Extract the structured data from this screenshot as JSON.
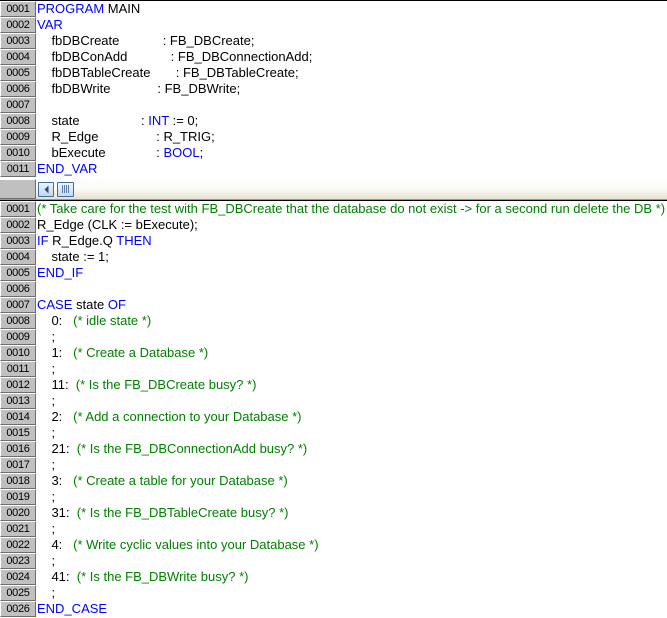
{
  "editor": {
    "title": "Structured Text Editor",
    "colors": {
      "keyword": "#0000ff",
      "comment": "#008000",
      "identifier": "#000000",
      "gutter_bg": "#c0c0c0",
      "editor_bg": "#ffffff"
    }
  },
  "declaration_pane": {
    "name": "declaration-editor",
    "lines": [
      {
        "num": "0001",
        "parts": [
          {
            "t": "PROGRAM ",
            "c": "kw"
          },
          {
            "t": "MAIN",
            "c": "plain"
          }
        ]
      },
      {
        "num": "0002",
        "parts": [
          {
            "t": "VAR",
            "c": "kw"
          }
        ]
      },
      {
        "num": "0003",
        "parts": [
          {
            "t": "    fbDBCreate            : FB_DBCreate;",
            "c": "plain"
          }
        ]
      },
      {
        "num": "0004",
        "parts": [
          {
            "t": "    fbDBConAdd            : FB_DBConnectionAdd;",
            "c": "plain"
          }
        ]
      },
      {
        "num": "0005",
        "parts": [
          {
            "t": "    fbDBTableCreate       : FB_DBTableCreate;",
            "c": "plain"
          }
        ]
      },
      {
        "num": "0006",
        "parts": [
          {
            "t": "    fbDBWrite             : FB_DBWrite;",
            "c": "plain"
          }
        ]
      },
      {
        "num": "0007",
        "parts": [
          {
            "t": "",
            "c": "plain"
          }
        ]
      },
      {
        "num": "0008",
        "parts": [
          {
            "t": "    state                 : ",
            "c": "plain"
          },
          {
            "t": "INT",
            "c": "kw"
          },
          {
            "t": " := 0;",
            "c": "plain"
          }
        ]
      },
      {
        "num": "0009",
        "parts": [
          {
            "t": "    R_Edge                : R_TRIG;",
            "c": "plain"
          }
        ]
      },
      {
        "num": "0010",
        "parts": [
          {
            "t": "    bExecute              : ",
            "c": "plain"
          },
          {
            "t": "BOOL",
            "c": "kw"
          },
          {
            "t": ";",
            "c": "plain"
          }
        ]
      },
      {
        "num": "0011",
        "parts": [
          {
            "t": "END_VAR",
            "c": "kw"
          }
        ]
      }
    ]
  },
  "scrollbar": {
    "name": "declaration-horizontal-scrollbar",
    "left_arrow_icon": "chevron-left-icon",
    "thumb_icon": "scrollbar-thumb-grip",
    "orientation": "horizontal"
  },
  "code_pane": {
    "name": "implementation-editor",
    "lines": [
      {
        "num": "0001",
        "parts": [
          {
            "t": "(* Take care for the test with FB_DBCreate that the database do not exist -> for a second run delete the DB *)",
            "c": "cmt"
          }
        ]
      },
      {
        "num": "0002",
        "parts": [
          {
            "t": "R_Edge (CLK := bExecute);",
            "c": "plain"
          }
        ]
      },
      {
        "num": "0003",
        "parts": [
          {
            "t": "IF",
            "c": "kw"
          },
          {
            "t": " R_Edge.Q ",
            "c": "plain"
          },
          {
            "t": "THEN",
            "c": "kw"
          }
        ]
      },
      {
        "num": "0004",
        "parts": [
          {
            "t": "    state := 1;",
            "c": "plain"
          }
        ]
      },
      {
        "num": "0005",
        "parts": [
          {
            "t": "END_IF",
            "c": "kw"
          }
        ]
      },
      {
        "num": "0006",
        "parts": [
          {
            "t": "",
            "c": "plain"
          }
        ]
      },
      {
        "num": "0007",
        "parts": [
          {
            "t": "CASE",
            "c": "kw"
          },
          {
            "t": " state ",
            "c": "plain"
          },
          {
            "t": "OF",
            "c": "kw"
          }
        ]
      },
      {
        "num": "0008",
        "parts": [
          {
            "t": "    0:   ",
            "c": "plain"
          },
          {
            "t": "(* idle state *)",
            "c": "cmt"
          }
        ]
      },
      {
        "num": "0009",
        "parts": [
          {
            "t": "    ;",
            "c": "plain"
          }
        ]
      },
      {
        "num": "0010",
        "parts": [
          {
            "t": "    1:   ",
            "c": "plain"
          },
          {
            "t": "(* Create a Database *)",
            "c": "cmt"
          }
        ]
      },
      {
        "num": "0011",
        "parts": [
          {
            "t": "    ;",
            "c": "plain"
          }
        ]
      },
      {
        "num": "0012",
        "parts": [
          {
            "t": "    11:  ",
            "c": "plain"
          },
          {
            "t": "(* Is the FB_DBCreate busy? *)",
            "c": "cmt"
          }
        ]
      },
      {
        "num": "0013",
        "parts": [
          {
            "t": "    ;",
            "c": "plain"
          }
        ]
      },
      {
        "num": "0014",
        "parts": [
          {
            "t": "    2:   ",
            "c": "plain"
          },
          {
            "t": "(* Add a connection to your Database *)",
            "c": "cmt"
          }
        ]
      },
      {
        "num": "0015",
        "parts": [
          {
            "t": "    ;",
            "c": "plain"
          }
        ]
      },
      {
        "num": "0016",
        "parts": [
          {
            "t": "    21:  ",
            "c": "plain"
          },
          {
            "t": "(* Is the FB_DBConnectionAdd busy? *)",
            "c": "cmt"
          }
        ]
      },
      {
        "num": "0017",
        "parts": [
          {
            "t": "    ;",
            "c": "plain"
          }
        ]
      },
      {
        "num": "0018",
        "parts": [
          {
            "t": "    3:   ",
            "c": "plain"
          },
          {
            "t": "(* Create a table for your Database *)",
            "c": "cmt"
          }
        ]
      },
      {
        "num": "0019",
        "parts": [
          {
            "t": "    ;",
            "c": "plain"
          }
        ]
      },
      {
        "num": "0020",
        "parts": [
          {
            "t": "    31:  ",
            "c": "plain"
          },
          {
            "t": "(* Is the FB_DBTableCreate busy? *)",
            "c": "cmt"
          }
        ]
      },
      {
        "num": "0021",
        "parts": [
          {
            "t": "    ;",
            "c": "plain"
          }
        ]
      },
      {
        "num": "0022",
        "parts": [
          {
            "t": "    4:   ",
            "c": "plain"
          },
          {
            "t": "(* Write cyclic values into your Database *)",
            "c": "cmt"
          }
        ]
      },
      {
        "num": "0023",
        "parts": [
          {
            "t": "    ;",
            "c": "plain"
          }
        ]
      },
      {
        "num": "0024",
        "parts": [
          {
            "t": "    41:  ",
            "c": "plain"
          },
          {
            "t": "(* Is the FB_DBWrite busy? *)",
            "c": "cmt"
          }
        ]
      },
      {
        "num": "0025",
        "parts": [
          {
            "t": "    ;",
            "c": "plain"
          }
        ]
      },
      {
        "num": "0026",
        "parts": [
          {
            "t": "END_CASE",
            "c": "kw"
          }
        ]
      }
    ]
  }
}
